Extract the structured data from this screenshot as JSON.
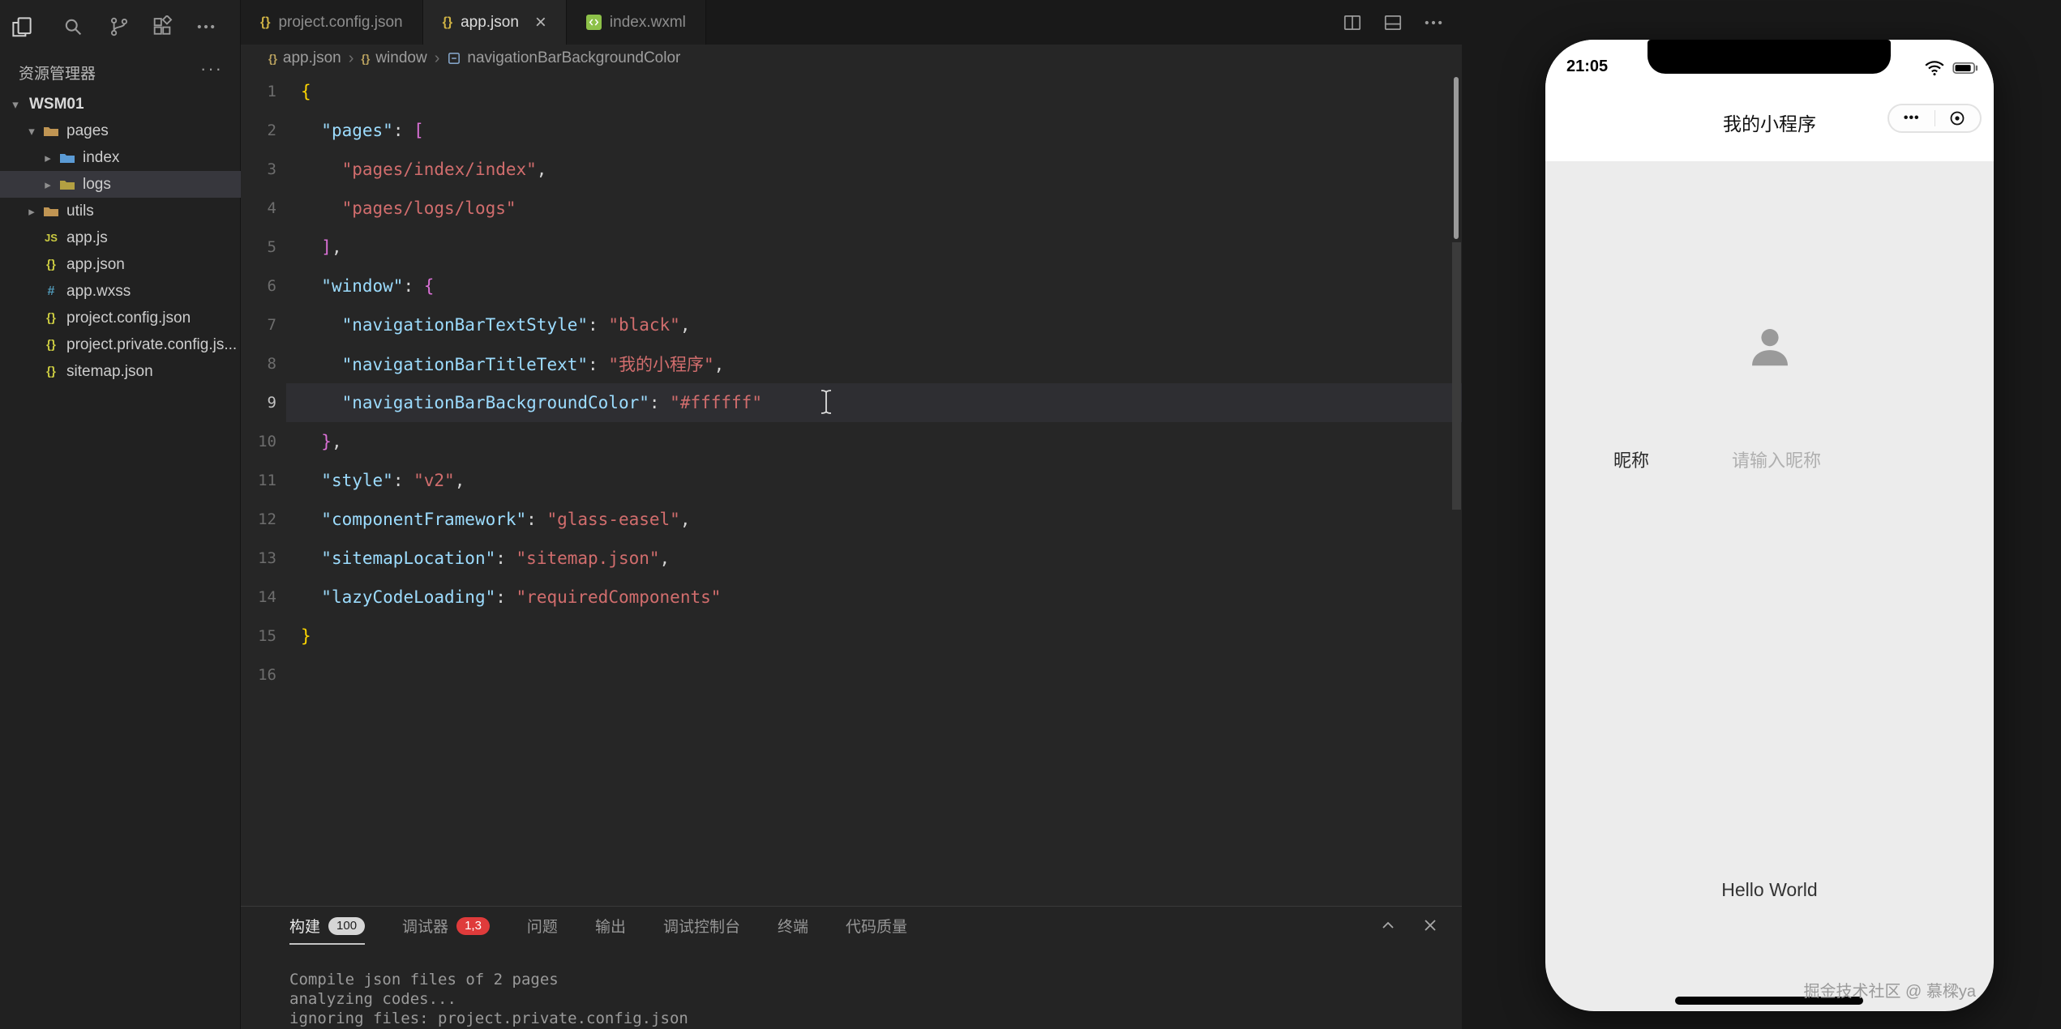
{
  "activity_bar": {
    "icons": [
      {
        "name": "files-icon"
      },
      {
        "name": "search-icon"
      },
      {
        "name": "git-branch-icon"
      },
      {
        "name": "extensions-icon"
      },
      {
        "name": "more-icon"
      }
    ]
  },
  "explorer": {
    "title": "资源管理器",
    "more": "···",
    "root": {
      "label": "WSM01"
    },
    "tree": [
      {
        "label": "pages",
        "depth": 1,
        "chev": "down",
        "icon": "folder",
        "color": "#c09553"
      },
      {
        "label": "index",
        "depth": 2,
        "chev": "right",
        "icon": "folder",
        "color": "#5b9bd5"
      },
      {
        "label": "logs",
        "depth": 2,
        "chev": "right",
        "icon": "folder",
        "color": "#b3a042",
        "selected": true
      },
      {
        "label": "utils",
        "depth": 1,
        "chev": "right",
        "icon": "folder",
        "color": "#c09553"
      },
      {
        "label": "app.js",
        "depth": 1,
        "chev": "none",
        "icon": "js",
        "color": "#cbcb41"
      },
      {
        "label": "app.json",
        "depth": 1,
        "chev": "none",
        "icon": "json",
        "color": "#cbcb41"
      },
      {
        "label": "app.wxss",
        "depth": 1,
        "chev": "none",
        "icon": "css",
        "color": "#519aba"
      },
      {
        "label": "project.config.json",
        "depth": 1,
        "chev": "none",
        "icon": "json",
        "color": "#cbcb41"
      },
      {
        "label": "project.private.config.js...",
        "depth": 1,
        "chev": "none",
        "icon": "json",
        "color": "#cbcb41"
      },
      {
        "label": "sitemap.json",
        "depth": 1,
        "chev": "none",
        "icon": "json",
        "color": "#cbcb41"
      }
    ]
  },
  "tabs": [
    {
      "label": "project.config.json",
      "icon": "json",
      "active": false
    },
    {
      "label": "app.json",
      "icon": "json",
      "active": true
    },
    {
      "label": "index.wxml",
      "icon": "wxml",
      "active": false
    }
  ],
  "editor_actions": [
    {
      "name": "split-editor-icon"
    },
    {
      "name": "layout-icon"
    },
    {
      "name": "more-icon"
    }
  ],
  "breadcrumb": {
    "segments": [
      {
        "label": "app.json",
        "icon": "braces"
      },
      {
        "label": "window",
        "icon": "braces"
      },
      {
        "label": "navigationBarBackgroundColor",
        "icon": "property"
      }
    ]
  },
  "editor": {
    "active_line": 9,
    "total_lines": 16,
    "lines": [
      [
        [
          "b1",
          "{"
        ]
      ],
      [
        [
          "p",
          "  "
        ],
        [
          "k",
          "\"pages\""
        ],
        [
          "p",
          ": "
        ],
        [
          "b2",
          "["
        ]
      ],
      [
        [
          "p",
          "    "
        ],
        [
          "s",
          "\"pages/index/index\""
        ],
        [
          "p",
          ","
        ]
      ],
      [
        [
          "p",
          "    "
        ],
        [
          "s",
          "\"pages/logs/logs\""
        ]
      ],
      [
        [
          "p",
          "  "
        ],
        [
          "b2",
          "]"
        ],
        [
          "p",
          ","
        ]
      ],
      [
        [
          "p",
          "  "
        ],
        [
          "k",
          "\"window\""
        ],
        [
          "p",
          ": "
        ],
        [
          "b2",
          "{"
        ]
      ],
      [
        [
          "p",
          "    "
        ],
        [
          "k",
          "\"navigationBarTextStyle\""
        ],
        [
          "p",
          ": "
        ],
        [
          "s",
          "\"black\""
        ],
        [
          "p",
          ","
        ]
      ],
      [
        [
          "p",
          "    "
        ],
        [
          "k",
          "\"navigationBarTitleText\""
        ],
        [
          "p",
          ": "
        ],
        [
          "s",
          "\"我的小程序\""
        ],
        [
          "p",
          ","
        ]
      ],
      [
        [
          "p",
          "    "
        ],
        [
          "k",
          "\"navigationBarBackgroundColor\""
        ],
        [
          "p",
          ": "
        ],
        [
          "s",
          "\"#ffffff\""
        ]
      ],
      [
        [
          "p",
          "  "
        ],
        [
          "b2",
          "}"
        ],
        [
          "p",
          ","
        ]
      ],
      [
        [
          "p",
          "  "
        ],
        [
          "k",
          "\"style\""
        ],
        [
          "p",
          ": "
        ],
        [
          "s",
          "\"v2\""
        ],
        [
          "p",
          ","
        ]
      ],
      [
        [
          "p",
          "  "
        ],
        [
          "k",
          "\"componentFramework\""
        ],
        [
          "p",
          ": "
        ],
        [
          "s",
          "\"glass-easel\""
        ],
        [
          "p",
          ","
        ]
      ],
      [
        [
          "p",
          "  "
        ],
        [
          "k",
          "\"sitemapLocation\""
        ],
        [
          "p",
          ": "
        ],
        [
          "s",
          "\"sitemap.json\""
        ],
        [
          "p",
          ","
        ]
      ],
      [
        [
          "p",
          "  "
        ],
        [
          "k",
          "\"lazyCodeLoading\""
        ],
        [
          "p",
          ": "
        ],
        [
          "s",
          "\"requiredComponents\""
        ]
      ],
      [
        [
          "b1",
          "}"
        ]
      ],
      []
    ]
  },
  "panel": {
    "tabs": [
      {
        "label": "构建",
        "badge": "100",
        "badge_style": "gray",
        "active": true
      },
      {
        "label": "调试器",
        "badge": "1,3",
        "badge_style": "red"
      },
      {
        "label": "问题"
      },
      {
        "label": "输出"
      },
      {
        "label": "调试控制台"
      },
      {
        "label": "终端"
      },
      {
        "label": "代码质量"
      }
    ],
    "console_lines": [
      "Compile json files of 2 pages",
      "analyzing codes...",
      "ignoring files: project.private.config.json"
    ]
  },
  "simulator": {
    "status_time": "21:05",
    "nav_title": "我的小程序",
    "capsule_more": "•••",
    "nickname_label": "昵称",
    "nickname_placeholder": "请输入昵称",
    "body_text": "Hello World",
    "watermark": "掘金技术社区 @ 慕樑ya"
  },
  "colors": {
    "editor_background": "#262626",
    "sidebar_background": "#212121",
    "json_key": "#9cdcfe",
    "json_string": "#d16d6d",
    "bracket_level1": "#ffd700",
    "bracket_level2": "#da70d6",
    "badge_red": "#df3b3b",
    "phone_content": "#ececec"
  }
}
